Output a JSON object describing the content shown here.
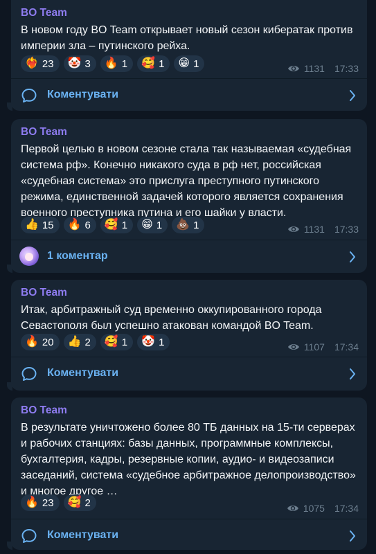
{
  "channel_name": "BO Team",
  "comment_label": "Коментувати",
  "posts": [
    {
      "text": "В новом году BO Team открывает новый сезон кибератак против империи зла – путинского рейха.",
      "reactions": [
        {
          "emoji": "❤️‍🔥",
          "count": "23"
        },
        {
          "emoji": "🤡",
          "count": "3"
        },
        {
          "emoji": "🔥",
          "count": "1"
        },
        {
          "emoji": "🥰",
          "count": "1"
        },
        {
          "emoji": "😁",
          "count": "1"
        }
      ],
      "views": "1131",
      "time": "17:33",
      "footer": "Коментувати"
    },
    {
      "text": "Первой целью в новом сезоне стала так называемая «судебная система рф». Конечно никакого суда в рф нет, российская «судебная система» это прислуга преступного путинского режима, единственной задачей которого является сохранения военного преступника путина и его шайки у власти.",
      "reactions": [
        {
          "emoji": "👍",
          "count": "15"
        },
        {
          "emoji": "🔥",
          "count": "6"
        },
        {
          "emoji": "🥰",
          "count": "1"
        },
        {
          "emoji": "😁",
          "count": "1"
        },
        {
          "emoji": "💩",
          "count": "1"
        }
      ],
      "views": "1131",
      "time": "17:33",
      "footer": "1 коментар"
    },
    {
      "text": "Итак, арбитражный суд временно оккупированного города Севастополя был успешно атакован командой BO Team.",
      "reactions": [
        {
          "emoji": "🔥",
          "count": "20"
        },
        {
          "emoji": "👍",
          "count": "2"
        },
        {
          "emoji": "🥰",
          "count": "1"
        },
        {
          "emoji": "🤡",
          "count": "1"
        }
      ],
      "views": "1107",
      "time": "17:34",
      "footer": "Коментувати"
    },
    {
      "text": "В результате уничтожено более 80 ТБ данных на 15-ти серверах и рабочих станциях: базы данных, программные комплексы, бухгалтерия, кадры, резервные копии, аудио- и видеозаписи заседаний, система «судебное арбитражное делопроизводство» и многое другое …",
      "reactions": [
        {
          "emoji": "🔥",
          "count": "23"
        },
        {
          "emoji": "🥰",
          "count": "2"
        }
      ],
      "views": "1075",
      "time": "17:34",
      "footer": "Коментувати"
    }
  ],
  "colors": {
    "background": "#0e1621",
    "bubble": "#182533",
    "channel_name": "#8e7cf0",
    "link": "#6ab2f2",
    "meta": "#6d7f8f",
    "reaction_bg": "#223447"
  },
  "icons": {
    "views": "eye-icon",
    "comment": "comment-bubble-icon",
    "chevron": "chevron-right-icon"
  }
}
